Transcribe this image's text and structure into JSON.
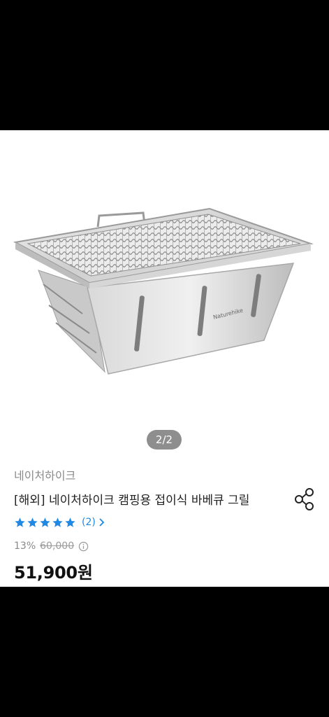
{
  "gallery": {
    "indicator": "2/2",
    "current": 2,
    "total": 2
  },
  "product": {
    "brand": "네이처하이크",
    "title": "[해외] 네이처하이크 캠핑용 접이식 바베큐 그릴",
    "rating": 5,
    "review_count": "(2)",
    "discount": "13%",
    "original_price": "60,000",
    "price": "51,900원",
    "logo_text": "Naturehike"
  },
  "icons": {
    "share": "share-icon",
    "star": "star-icon",
    "chevron": "chevron-right-icon",
    "info": "info-icon"
  },
  "colors": {
    "accent_blue": "#1e88e5",
    "muted_gray": "#8a8a8a"
  }
}
